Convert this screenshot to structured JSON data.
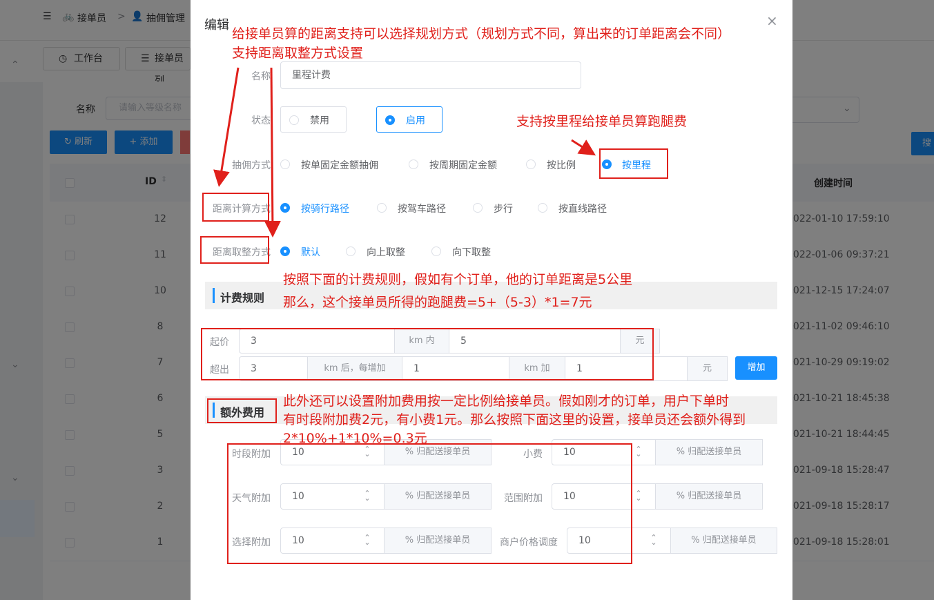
{
  "background": {
    "breadcrumb": {
      "menu_icon": "menu-fold-icon",
      "item1": "接单员",
      "sep": ">",
      "item2": "抽佣管理"
    },
    "tabs": [
      {
        "label": "工作台"
      },
      {
        "label": "接单员列"
      }
    ],
    "filter": {
      "name_label": "名称",
      "name_placeholder": "请输入等级名称"
    },
    "buttons": {
      "refresh": "刷新",
      "add": "添加",
      "search": "搜索"
    },
    "table": {
      "headers": {
        "id": "ID",
        "created": "创建时间"
      },
      "rows": [
        {
          "id": "12",
          "created": "2022-01-10 17:59:10"
        },
        {
          "id": "11",
          "created": "2022-01-06 09:37:21"
        },
        {
          "id": "10",
          "created": "2021-12-15 17:24:07"
        },
        {
          "id": "8",
          "created": "2021-11-02 09:46:10"
        },
        {
          "id": "7",
          "created": "2021-10-29 09:19:02"
        },
        {
          "id": "6",
          "created": "2021-10-21 18:45:38"
        },
        {
          "id": "5",
          "created": "2021-10-21 18:44:45"
        },
        {
          "id": "3",
          "created": "2021-09-18 15:28:47"
        },
        {
          "id": "2",
          "created": "2021-09-18 15:28:17"
        },
        {
          "id": "1",
          "created": "2021-09-18 15:28:01"
        }
      ]
    }
  },
  "dialog": {
    "title": "编辑",
    "close_glyph": "×",
    "name": {
      "label": "名称",
      "value": "里程计费"
    },
    "status": {
      "label": "状态",
      "options": [
        "禁用",
        "启用"
      ],
      "selected": 1
    },
    "commission": {
      "label": "抽佣方式",
      "options": [
        "按单固定金额抽佣",
        "按周期固定金额",
        "按比例",
        "按里程"
      ],
      "selected": 3
    },
    "distance_calc": {
      "label": "距离计算方式",
      "options": [
        "按骑行路径",
        "按驾车路径",
        "步行",
        "按直线路径"
      ],
      "selected": 0
    },
    "distance_round": {
      "label": "距离取整方式",
      "options": [
        "默认",
        "向上取整",
        "向下取整"
      ],
      "selected": 0
    },
    "pricing": {
      "title": "计费规则",
      "start": {
        "label": "起价",
        "value1": "3",
        "unit1": "km 内",
        "value2": "5",
        "unit2": "元"
      },
      "over": {
        "label": "超出",
        "value1": "3",
        "unit1": "km 后，每增加",
        "value2": "1",
        "unit2": "km 加",
        "value3": "1",
        "unit3": "元"
      },
      "add_button": "增加"
    },
    "extra": {
      "title": "额外费用",
      "suffix": "% 归配送接单员",
      "fields": [
        {
          "label": "时段附加",
          "value": "10"
        },
        {
          "label": "小费",
          "value": "10"
        },
        {
          "label": "天气附加",
          "value": "10"
        },
        {
          "label": "范围附加",
          "value": "10"
        },
        {
          "label": "选择附加",
          "value": "10"
        },
        {
          "label": "商户价格调度",
          "value": "10"
        }
      ]
    }
  },
  "annotations": {
    "top_line1": "给接单员算的距离支持可以选择规划方式（规划方式不同，算出来的订单距离会不同）",
    "top_line2": "支持距离取整方式设置",
    "mileage_note": "支持按里程给接单员算跑腿费",
    "rule_line1": "按照下面的计费规则，假如有个订单，他的订单距离是5公里",
    "rule_line2": "那么，这个接单员所得的跑腿费=5+（5-3）*1=7元",
    "extra_line1": "此外还可以设置附加费用按一定比例给接单员。假如刚才的订单，用户下单时",
    "extra_line2": "有时段附加费2元，有小费1元。那么按照下面这里的设置，接单员还会额外得到",
    "extra_line3": "2*10%+1*10%=0.3元",
    "color": "#e0201b"
  }
}
